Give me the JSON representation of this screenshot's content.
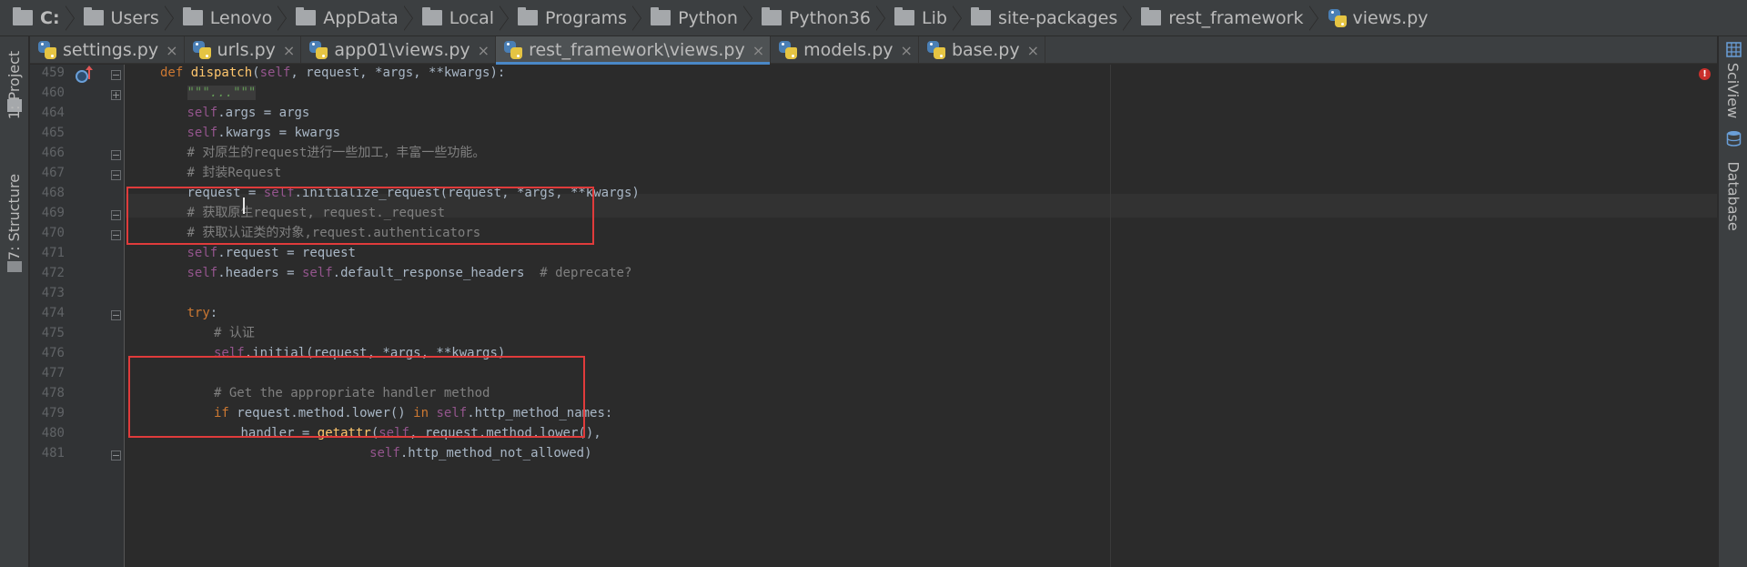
{
  "breadcrumb": [
    {
      "label": "C:",
      "bold": true,
      "icon": "folder-icon"
    },
    {
      "label": "Users",
      "icon": "folder-icon"
    },
    {
      "label": "Lenovo",
      "icon": "folder-icon"
    },
    {
      "label": "AppData",
      "icon": "folder-icon"
    },
    {
      "label": "Local",
      "icon": "folder-icon"
    },
    {
      "label": "Programs",
      "icon": "folder-icon"
    },
    {
      "label": "Python",
      "icon": "folder-icon"
    },
    {
      "label": "Python36",
      "icon": "folder-icon"
    },
    {
      "label": "Lib",
      "icon": "folder-icon"
    },
    {
      "label": "site-packages",
      "icon": "folder-icon"
    },
    {
      "label": "rest_framework",
      "icon": "folder-icon"
    },
    {
      "label": "views.py",
      "icon": "python-file-icon"
    }
  ],
  "tabs": [
    {
      "label": "settings.py",
      "active": false
    },
    {
      "label": "urls.py",
      "active": false
    },
    {
      "label": "app01\\views.py",
      "active": false
    },
    {
      "label": "rest_framework\\views.py",
      "active": true
    },
    {
      "label": "models.py",
      "active": false
    },
    {
      "label": "base.py",
      "active": false
    }
  ],
  "tab_close_glyph": "×",
  "left_tools": [
    {
      "label": "1: Project",
      "icon": "project-icon"
    },
    {
      "label": "7: Structure",
      "icon": "structure-icon"
    }
  ],
  "right_tools": [
    {
      "label": "SciView",
      "icon": "sciview-icon"
    },
    {
      "label": "Database",
      "icon": "database-icon"
    }
  ],
  "error_indicator": "!",
  "code_lines": [
    {
      "num": "459",
      "tokens": [
        [
          "kw",
          "def "
        ],
        [
          "fn",
          "dispatch"
        ],
        [
          "plain",
          "("
        ],
        [
          "self",
          "self"
        ],
        [
          "plain",
          ", request, *args, **kwargs):"
        ]
      ]
    },
    {
      "num": "460",
      "tokens": [
        [
          "ds",
          "\"\"\"...\"\"\""
        ]
      ]
    },
    {
      "num": "464",
      "tokens": [
        [
          "self",
          "self"
        ],
        [
          "plain",
          ".args = args"
        ]
      ]
    },
    {
      "num": "465",
      "tokens": [
        [
          "self",
          "self"
        ],
        [
          "plain",
          ".kwargs = kwargs"
        ]
      ]
    },
    {
      "num": "466",
      "tokens": [
        [
          "cm",
          "# 对原生的request进行一些加工，丰富一些功能。"
        ]
      ]
    },
    {
      "num": "467",
      "tokens": [
        [
          "cm",
          "# 封装Request"
        ]
      ]
    },
    {
      "num": "468",
      "tokens": [
        [
          "plain",
          "request = "
        ],
        [
          "self",
          "self"
        ],
        [
          "plain",
          ".initialize_request(request, *args, **kwargs)"
        ]
      ]
    },
    {
      "num": "469",
      "tokens": [
        [
          "cm",
          "# 获取原生request, request._request"
        ]
      ]
    },
    {
      "num": "470",
      "tokens": [
        [
          "cm",
          "# 获取认证类的对象,request.authenticators"
        ]
      ]
    },
    {
      "num": "471",
      "tokens": [
        [
          "self",
          "self"
        ],
        [
          "plain",
          ".request = request"
        ]
      ]
    },
    {
      "num": "472",
      "tokens": [
        [
          "self",
          "self"
        ],
        [
          "plain",
          ".headers = "
        ],
        [
          "self",
          "self"
        ],
        [
          "plain",
          ".default_response_headers  "
        ],
        [
          "cm",
          "# deprecate?"
        ]
      ]
    },
    {
      "num": "473",
      "tokens": []
    },
    {
      "num": "474",
      "tokens": [
        [
          "kw",
          "try"
        ],
        [
          "plain",
          ":"
        ]
      ]
    },
    {
      "num": "475",
      "tokens": [
        [
          "cm",
          "# 认证"
        ]
      ]
    },
    {
      "num": "476",
      "tokens": [
        [
          "self",
          "self"
        ],
        [
          "plain",
          ".initial(request, *args, **kwargs)"
        ]
      ]
    },
    {
      "num": "477",
      "tokens": []
    },
    {
      "num": "478",
      "tokens": [
        [
          "cm",
          "# Get the appropriate handler method"
        ]
      ]
    },
    {
      "num": "479",
      "tokens": [
        [
          "kw",
          "if "
        ],
        [
          "plain",
          "request.method.lower() "
        ],
        [
          "kw",
          "in "
        ],
        [
          "self",
          "self"
        ],
        [
          "plain",
          ".http_method_names:"
        ]
      ]
    },
    {
      "num": "480",
      "tokens": [
        [
          "plain",
          "handler = "
        ],
        [
          "fn",
          "getattr"
        ],
        [
          "plain",
          "("
        ],
        [
          "self",
          "self"
        ],
        [
          "plain",
          ", request.method.lower(),"
        ]
      ]
    },
    {
      "num": "481",
      "tokens": [
        [
          "self",
          "self"
        ],
        [
          "plain",
          ".http_method_not_allowed)"
        ]
      ]
    }
  ],
  "colors": {
    "keyword": "#cc7832",
    "function": "#ffc66d",
    "self": "#94558d",
    "comment": "#808080",
    "text": "#a9b7c6",
    "highlight_box": "#e03b3b",
    "active_tab_underline": "#4a88c7"
  }
}
